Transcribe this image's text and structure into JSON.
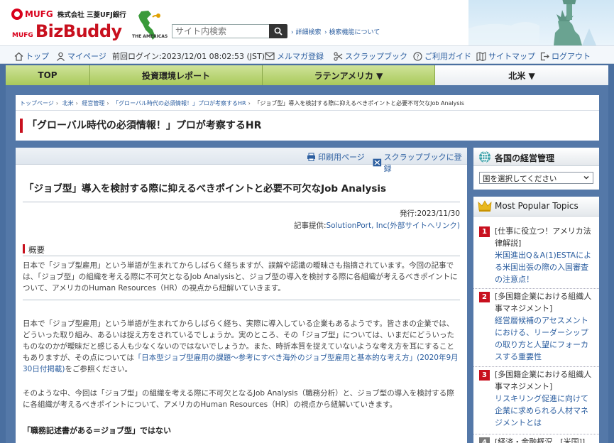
{
  "header": {
    "mufg_logo": "MUFG",
    "bank_name": "株式会社 三菱UFJ銀行",
    "bizbuddy_prefix": "MUFG",
    "bizbuddy_name": "BizBuddy",
    "globe_caption": "THE AMERICAS",
    "search_placeholder": "サイト内検索",
    "advanced_search": "詳細検索",
    "about_search": "検索機能について"
  },
  "utility": {
    "top": "トップ",
    "mypage": "マイページ",
    "last_login": "前回ログイン:2023/12/01 08:02:53 (JST)",
    "newsletter": "メルマガ登録",
    "scrapbook": "スクラップブック",
    "guide": "ご利用ガイド",
    "sitemap": "サイトマップ",
    "logout": "ログアウト"
  },
  "nav": {
    "top": "TOP",
    "investment": "投資環境レポート",
    "latin": "ラテンアメリカ ▼",
    "north": "北米 ▼"
  },
  "breadcrumb": {
    "top": "トップページ",
    "north": "北米",
    "mgmt": "経営管理",
    "series": "「グローバル時代の必須情報！」プロが考察するHR",
    "current": "「ジョブ型」導入を検討する際に抑えるべきポイントと必要不可欠なJob Analysis"
  },
  "category_title": "「グローバル時代の必須情報！」プロが考察するHR",
  "article": {
    "print": "印刷用ページ",
    "scrap": "スクラップブックに登録",
    "title": "「ジョブ型」導入を検討する際に抑えるべきポイントと必要不可欠なJob Analysis",
    "date": "発行:2023/11/30",
    "provider_label": "記事提供:",
    "provider_link": "SolutionPort, Inc(外部サイトへリンク)",
    "overview_label": "概要",
    "overview_text": "日本で「ジョブ型雇用」という単語が生まれてからしばらく経ちますが、誤解や認識の曖昧さも指摘されています。今回の記事では、「ジョブ型」の組織を考える際に不可欠となるJob Analysisと、ジョブ型の導入を検討する際に各組織が考えるべきポイントについて、アメリカのHuman Resources（HR）の視点から紐解いていきます。",
    "body1_a": "日本で「ジョブ型雇用」という単語が生まれてからしばらく経ち、実際に導入している企業もあるようです。皆さまの企業では、どういった取り組み、あるいは捉え方をされているでしょうか。実のところ、その「ジョブ型」については、いまだにどういったものなのかが曖昧だと感じる人も少なくないのではないでしょうか。また、時折本質を捉えていないような考え方を耳にすることもありますが、その点については",
    "body1_link": "「日本型ジョブ型雇用の課題～参考にすべき海外のジョブ型雇用と基本的な考え方」(2020年9月30日付掲載)",
    "body1_b": "をご参照ください。",
    "body2": "そのような中、今回は「ジョブ型」の組織を考える際に不可欠となるJob Analysis（職務分析）と、ジョブ型の導入を検討する際に各組織が考えるべきポイントについて、アメリカのHuman Resources（HR）の視点から紐解いていきます。",
    "subhead": "「職務記述書がある＝ジョブ型」ではない"
  },
  "sidebar": {
    "country_title": "各国の経営管理",
    "country_select": "国を選択してください",
    "popular_title": "Most Popular Topics",
    "items": [
      {
        "rank": "1",
        "category": "[仕事に役立つ！アメリカ法律解説]",
        "link": "米国進出Q＆A(1)ESTAによる米国出張の際の入国審査の注意点！"
      },
      {
        "rank": "2",
        "category": "[多国籍企業における組織人事マネジメント]",
        "link": "経営層候補のアセスメントにおける、リーダーシップの取り方と人望にフォーカスする重要性"
      },
      {
        "rank": "3",
        "category": "[多国籍企業における組織人事マネジメント]",
        "link": "リスキリング促進に向けて企業に求められる人材マネジメントとは"
      },
      {
        "rank": "4",
        "category": "[経済・金融概況　[米国]]",
        "link": ""
      }
    ]
  }
}
